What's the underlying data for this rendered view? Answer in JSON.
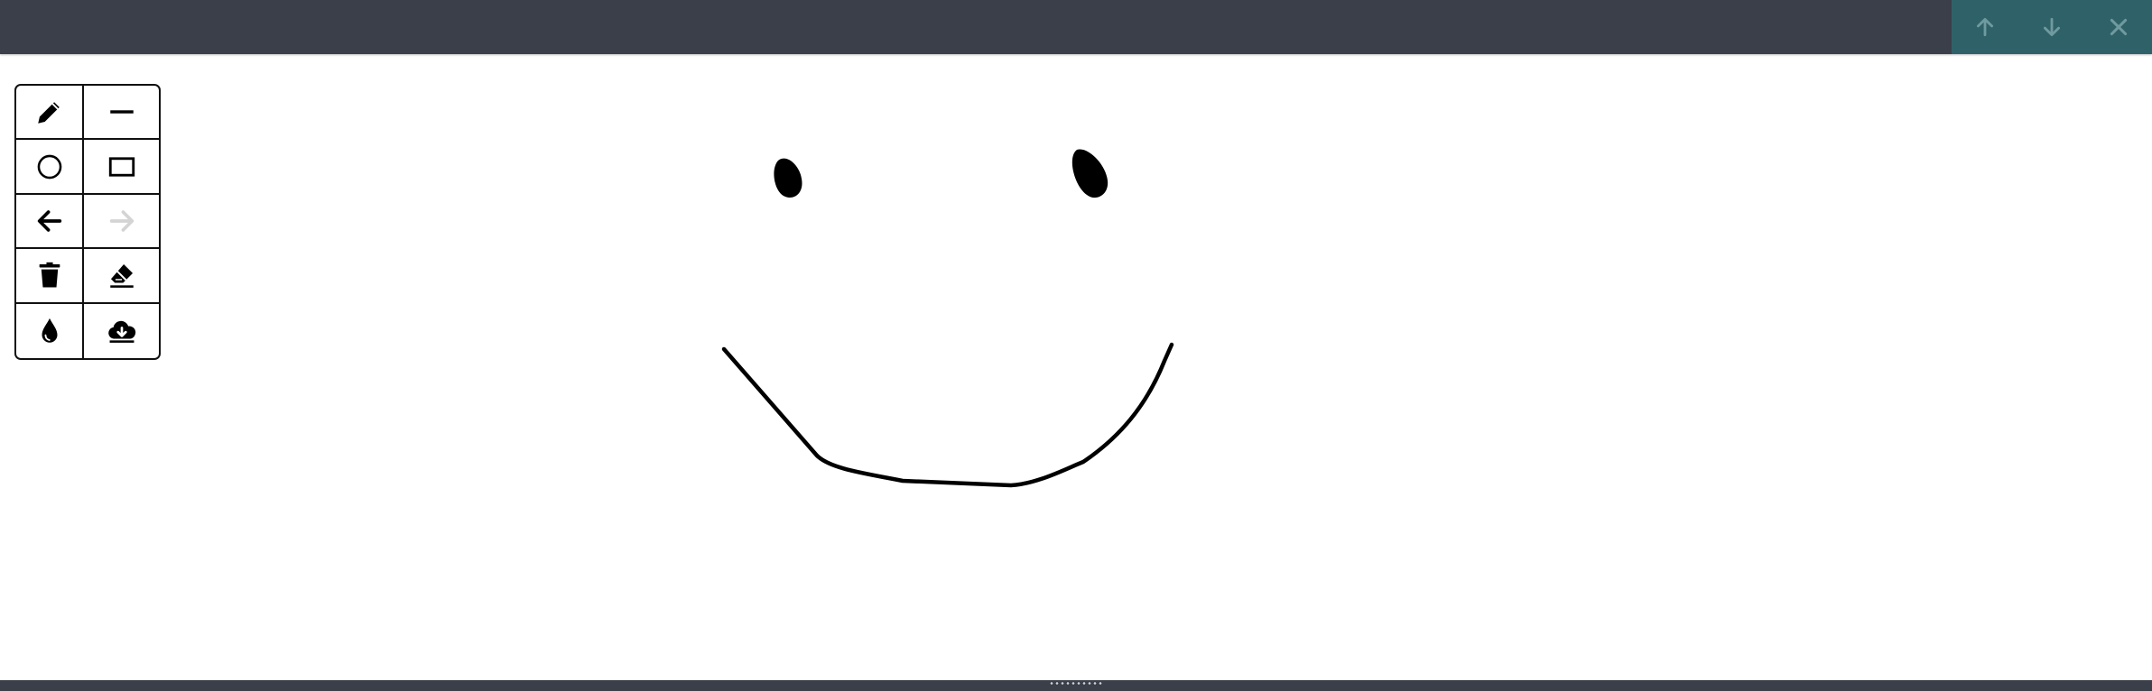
{
  "topbar": {
    "nav": [
      {
        "name": "arrow-up-icon"
      },
      {
        "name": "arrow-down-icon"
      },
      {
        "name": "close-icon"
      }
    ],
    "accent_color": "#2f6268",
    "bar_color": "#3b3f4a"
  },
  "toolbox": {
    "tools": [
      {
        "name": "pencil-icon",
        "enabled": true
      },
      {
        "name": "line-icon",
        "enabled": true
      },
      {
        "name": "circle-icon",
        "enabled": true
      },
      {
        "name": "rectangle-icon",
        "enabled": true
      },
      {
        "name": "undo-icon",
        "enabled": true
      },
      {
        "name": "redo-icon",
        "enabled": false
      },
      {
        "name": "trash-icon",
        "enabled": true
      },
      {
        "name": "eraser-icon",
        "enabled": true
      },
      {
        "name": "ink-drop-icon",
        "enabled": true
      },
      {
        "name": "cloud-download-icon",
        "enabled": true
      }
    ]
  },
  "canvas": {
    "ink_color": "#000000"
  },
  "bottombar": {
    "grip_icon": "resize-grip-icon"
  }
}
